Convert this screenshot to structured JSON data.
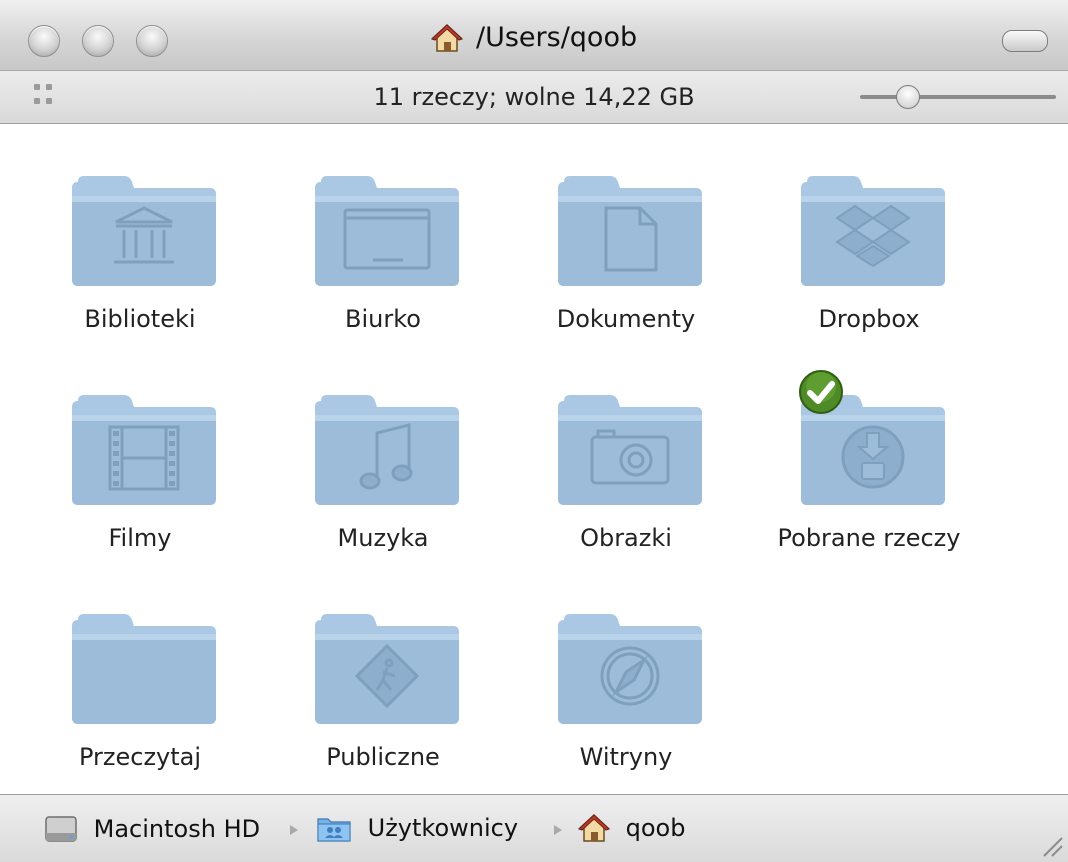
{
  "window": {
    "title": "/Users/qoob",
    "status": "11 rzeczy; wolne 14,22 GB"
  },
  "folders": [
    {
      "label": "Biblioteki",
      "icon": "library-icon"
    },
    {
      "label": "Biurko",
      "icon": "desktop-icon"
    },
    {
      "label": "Dokumenty",
      "icon": "document-icon"
    },
    {
      "label": "Dropbox",
      "icon": "dropbox-icon",
      "badge": "sync-complete-check-icon"
    },
    {
      "label": "Filmy",
      "icon": "film-icon"
    },
    {
      "label": "Muzyka",
      "icon": "music-note-icon"
    },
    {
      "label": "Obrazki",
      "icon": "camera-icon"
    },
    {
      "label": "Pobrane rzeczy",
      "icon": "download-icon"
    },
    {
      "label": "Przeczytaj",
      "icon": "plain-folder-icon"
    },
    {
      "label": "Publiczne",
      "icon": "public-sign-icon"
    },
    {
      "label": "Witryny",
      "icon": "compass-icon"
    }
  ],
  "pathbar": {
    "items": [
      {
        "label": "Macintosh HD",
        "icon": "hard-drive-icon"
      },
      {
        "label": "Użytkownicy",
        "icon": "users-folder-icon"
      },
      {
        "label": "qoob",
        "icon": "home-icon"
      }
    ]
  },
  "colors": {
    "folder_body": "#9dbcd9",
    "folder_tab": "#aac8e3",
    "folder_emboss": "#7f9fbf",
    "badge_green": "#4e8a26"
  }
}
